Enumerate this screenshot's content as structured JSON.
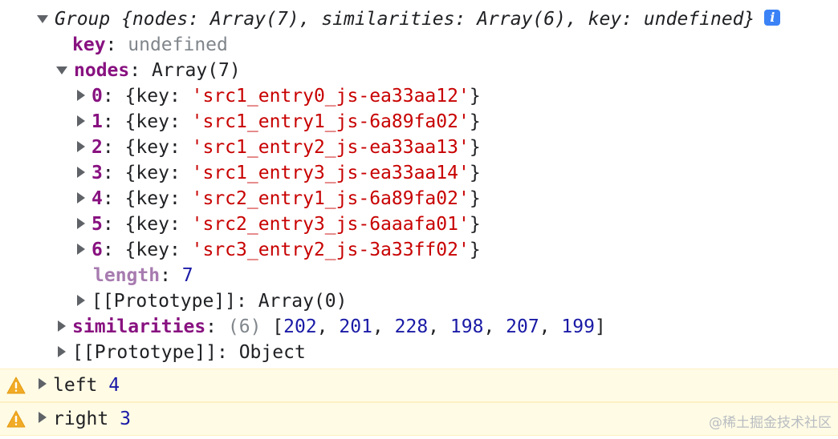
{
  "group": {
    "header": "Group {nodes: Array(7), similarities: Array(6), key: undefined}",
    "info_badge": "i"
  },
  "key_row": {
    "name": "key",
    "value": "undefined"
  },
  "nodes": {
    "name": "nodes",
    "summary": "Array(7)",
    "items": [
      {
        "index": "0",
        "key": "'src1_entry0_js-ea33aa12'"
      },
      {
        "index": "1",
        "key": "'src1_entry1_js-6a89fa02'"
      },
      {
        "index": "2",
        "key": "'src1_entry2_js-ea33aa13'"
      },
      {
        "index": "3",
        "key": "'src1_entry3_js-ea33aa14'"
      },
      {
        "index": "4",
        "key": "'src2_entry1_js-6a89fa02'"
      },
      {
        "index": "5",
        "key": "'src2_entry3_js-6aaafa01'"
      },
      {
        "index": "6",
        "key": "'src3_entry2_js-3a33ff02'"
      }
    ],
    "length_name": "length",
    "length_value": "7",
    "prototype": "[[Prototype]]: Array(0)"
  },
  "similarities": {
    "name": "similarities",
    "count": "(6)",
    "values": [
      "202",
      "201",
      "228",
      "198",
      "207",
      "199"
    ]
  },
  "group_prototype": "[[Prototype]]: Object",
  "warnings": [
    {
      "label": "left",
      "value": "4"
    },
    {
      "label": "right",
      "value": "3"
    }
  ],
  "watermark": "@稀土掘金技术社区",
  "colors": {
    "key_purple": "#881280",
    "string_red": "#c80000",
    "number_blue": "#1a1aa6",
    "dim_gray": "#80868b",
    "warning_bg": "#fffbe5",
    "warning_icon": "#f2ab26",
    "info_badge": "#3b82f6"
  },
  "icons": {
    "expand": "triangle-right-icon",
    "collapse": "triangle-down-icon",
    "warning": "warning-icon",
    "info": "info-icon"
  }
}
